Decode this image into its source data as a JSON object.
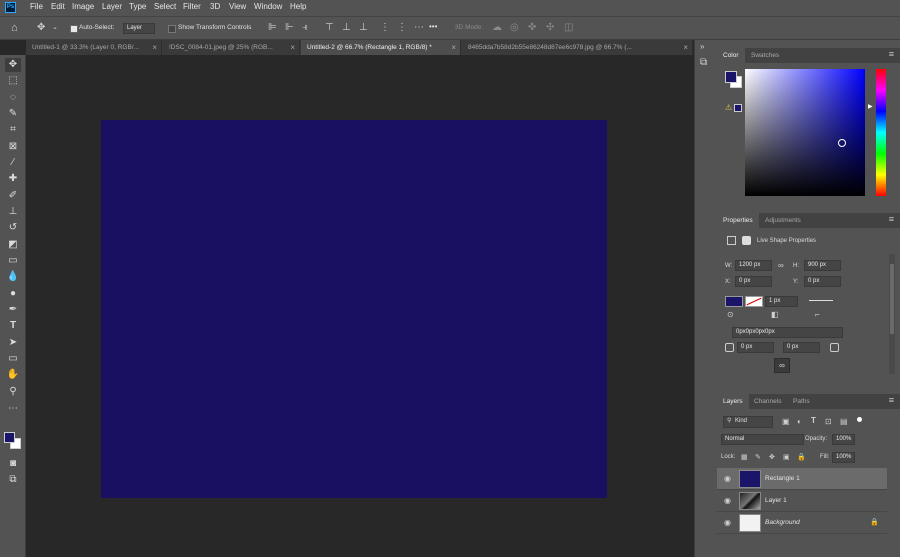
{
  "app": {
    "logo": "Ps"
  },
  "menu": [
    "File",
    "Edit",
    "Image",
    "Layer",
    "Type",
    "Select",
    "Filter",
    "3D",
    "View",
    "Window",
    "Help"
  ],
  "options": {
    "auto_select_label": "Auto-Select:",
    "auto_select_value": "Layer",
    "transform_label": "Show Transform Controls",
    "mode_3d": "3D Mode:",
    "more": "•••"
  },
  "tabs": [
    {
      "label": "Untitled-1 @ 33.3% (Layer 0, RGB/...",
      "close": "×"
    },
    {
      "label": "!DSC_0084-01.jpeg @ 25% (RGB...",
      "close": "×"
    },
    {
      "label": "Untitled-2 @ 66.7% (Rectangle 1, RGB/8) *",
      "close": "×"
    },
    {
      "label": "8465dda7b58d2b55e86248d87ee6c978.jpg @ 66.7% (...",
      "close": "×"
    }
  ],
  "colors": {
    "foreground": "#1a1569",
    "canvas_fill": "#1a1061",
    "background_swatch": "#ffffff"
  },
  "color_panel": {
    "tabs": [
      "Color",
      "Swatches"
    ]
  },
  "properties": {
    "tabs": [
      "Properties",
      "Adjustments"
    ],
    "title": "Live Shape Properties",
    "w_label": "W:",
    "w": "1200 px",
    "h_label": "H:",
    "h": "900 px",
    "x_label": "X:",
    "x": "0 px",
    "y_label": "Y:",
    "y": "0 px",
    "stroke_width": "1 px",
    "radii": "0px0px0px0px",
    "radius_left": "0 px",
    "radius_right": "0 px"
  },
  "layers_panel": {
    "tabs": [
      "Layers",
      "Channels",
      "Paths"
    ],
    "kind_label": "Kind",
    "blend_mode": "Normal",
    "opacity_label": "Opacity:",
    "opacity": "100%",
    "lock_label": "Lock:",
    "fill_label": "Fill:",
    "fill": "100%",
    "layers": [
      {
        "name": "Rectangle 1",
        "selected": true
      },
      {
        "name": "Layer 1",
        "selected": false
      },
      {
        "name": "Background",
        "selected": false,
        "locked": true
      }
    ]
  }
}
